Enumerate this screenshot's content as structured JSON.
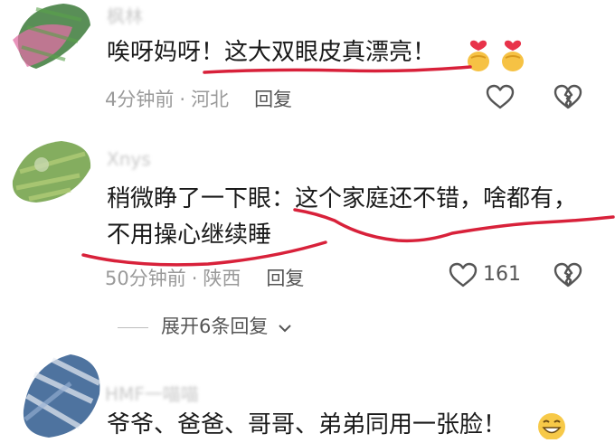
{
  "colors": {
    "underline": "#d8213a",
    "meta": "#9a9a9a",
    "text": "#1a1a1a"
  },
  "comments": [
    {
      "username": "枫林",
      "text_lines": [
        "唉呀妈呀！这大双眼皮真漂亮！"
      ],
      "time": "4分钟前",
      "location": "河北",
      "reply_label": "回复",
      "like_count": "",
      "emojis": [
        "heart-hands-emoji",
        "heart-hands-emoji"
      ]
    },
    {
      "username": "Xnys",
      "text_lines": [
        "稍微睁了一下眼：这个家庭还不错，啥都有，",
        "不用操心继续睡"
      ],
      "time": "50分钟前",
      "location": "陕西",
      "reply_label": "回复",
      "like_count": "161"
    },
    {
      "username": "HMF一喵喵",
      "text_lines": [
        "爷爷、爸爸、哥哥、弟弟同用一张脸！"
      ],
      "emojis": [
        "grin-emoji"
      ]
    }
  ],
  "expand_replies": "展开6条回复"
}
